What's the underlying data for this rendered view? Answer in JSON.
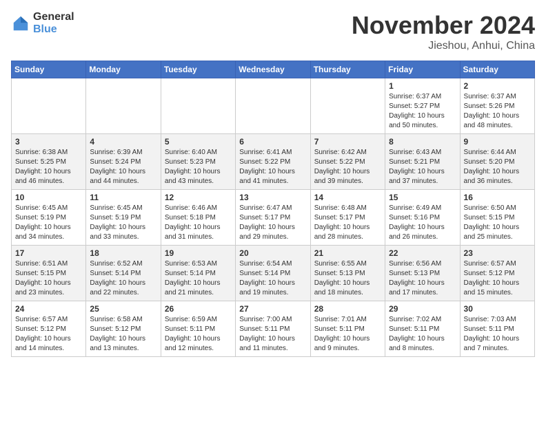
{
  "logo": {
    "general": "General",
    "blue": "Blue"
  },
  "title": "November 2024",
  "location": "Jieshou, Anhui, China",
  "days_header": [
    "Sunday",
    "Monday",
    "Tuesday",
    "Wednesday",
    "Thursday",
    "Friday",
    "Saturday"
  ],
  "weeks": [
    [
      {
        "day": "",
        "info": ""
      },
      {
        "day": "",
        "info": ""
      },
      {
        "day": "",
        "info": ""
      },
      {
        "day": "",
        "info": ""
      },
      {
        "day": "",
        "info": ""
      },
      {
        "day": "1",
        "info": "Sunrise: 6:37 AM\nSunset: 5:27 PM\nDaylight: 10 hours\nand 50 minutes."
      },
      {
        "day": "2",
        "info": "Sunrise: 6:37 AM\nSunset: 5:26 PM\nDaylight: 10 hours\nand 48 minutes."
      }
    ],
    [
      {
        "day": "3",
        "info": "Sunrise: 6:38 AM\nSunset: 5:25 PM\nDaylight: 10 hours\nand 46 minutes."
      },
      {
        "day": "4",
        "info": "Sunrise: 6:39 AM\nSunset: 5:24 PM\nDaylight: 10 hours\nand 44 minutes."
      },
      {
        "day": "5",
        "info": "Sunrise: 6:40 AM\nSunset: 5:23 PM\nDaylight: 10 hours\nand 43 minutes."
      },
      {
        "day": "6",
        "info": "Sunrise: 6:41 AM\nSunset: 5:22 PM\nDaylight: 10 hours\nand 41 minutes."
      },
      {
        "day": "7",
        "info": "Sunrise: 6:42 AM\nSunset: 5:22 PM\nDaylight: 10 hours\nand 39 minutes."
      },
      {
        "day": "8",
        "info": "Sunrise: 6:43 AM\nSunset: 5:21 PM\nDaylight: 10 hours\nand 37 minutes."
      },
      {
        "day": "9",
        "info": "Sunrise: 6:44 AM\nSunset: 5:20 PM\nDaylight: 10 hours\nand 36 minutes."
      }
    ],
    [
      {
        "day": "10",
        "info": "Sunrise: 6:45 AM\nSunset: 5:19 PM\nDaylight: 10 hours\nand 34 minutes."
      },
      {
        "day": "11",
        "info": "Sunrise: 6:45 AM\nSunset: 5:19 PM\nDaylight: 10 hours\nand 33 minutes."
      },
      {
        "day": "12",
        "info": "Sunrise: 6:46 AM\nSunset: 5:18 PM\nDaylight: 10 hours\nand 31 minutes."
      },
      {
        "day": "13",
        "info": "Sunrise: 6:47 AM\nSunset: 5:17 PM\nDaylight: 10 hours\nand 29 minutes."
      },
      {
        "day": "14",
        "info": "Sunrise: 6:48 AM\nSunset: 5:17 PM\nDaylight: 10 hours\nand 28 minutes."
      },
      {
        "day": "15",
        "info": "Sunrise: 6:49 AM\nSunset: 5:16 PM\nDaylight: 10 hours\nand 26 minutes."
      },
      {
        "day": "16",
        "info": "Sunrise: 6:50 AM\nSunset: 5:15 PM\nDaylight: 10 hours\nand 25 minutes."
      }
    ],
    [
      {
        "day": "17",
        "info": "Sunrise: 6:51 AM\nSunset: 5:15 PM\nDaylight: 10 hours\nand 23 minutes."
      },
      {
        "day": "18",
        "info": "Sunrise: 6:52 AM\nSunset: 5:14 PM\nDaylight: 10 hours\nand 22 minutes."
      },
      {
        "day": "19",
        "info": "Sunrise: 6:53 AM\nSunset: 5:14 PM\nDaylight: 10 hours\nand 21 minutes."
      },
      {
        "day": "20",
        "info": "Sunrise: 6:54 AM\nSunset: 5:14 PM\nDaylight: 10 hours\nand 19 minutes."
      },
      {
        "day": "21",
        "info": "Sunrise: 6:55 AM\nSunset: 5:13 PM\nDaylight: 10 hours\nand 18 minutes."
      },
      {
        "day": "22",
        "info": "Sunrise: 6:56 AM\nSunset: 5:13 PM\nDaylight: 10 hours\nand 17 minutes."
      },
      {
        "day": "23",
        "info": "Sunrise: 6:57 AM\nSunset: 5:12 PM\nDaylight: 10 hours\nand 15 minutes."
      }
    ],
    [
      {
        "day": "24",
        "info": "Sunrise: 6:57 AM\nSunset: 5:12 PM\nDaylight: 10 hours\nand 14 minutes."
      },
      {
        "day": "25",
        "info": "Sunrise: 6:58 AM\nSunset: 5:12 PM\nDaylight: 10 hours\nand 13 minutes."
      },
      {
        "day": "26",
        "info": "Sunrise: 6:59 AM\nSunset: 5:11 PM\nDaylight: 10 hours\nand 12 minutes."
      },
      {
        "day": "27",
        "info": "Sunrise: 7:00 AM\nSunset: 5:11 PM\nDaylight: 10 hours\nand 11 minutes."
      },
      {
        "day": "28",
        "info": "Sunrise: 7:01 AM\nSunset: 5:11 PM\nDaylight: 10 hours\nand 9 minutes."
      },
      {
        "day": "29",
        "info": "Sunrise: 7:02 AM\nSunset: 5:11 PM\nDaylight: 10 hours\nand 8 minutes."
      },
      {
        "day": "30",
        "info": "Sunrise: 7:03 AM\nSunset: 5:11 PM\nDaylight: 10 hours\nand 7 minutes."
      }
    ]
  ]
}
